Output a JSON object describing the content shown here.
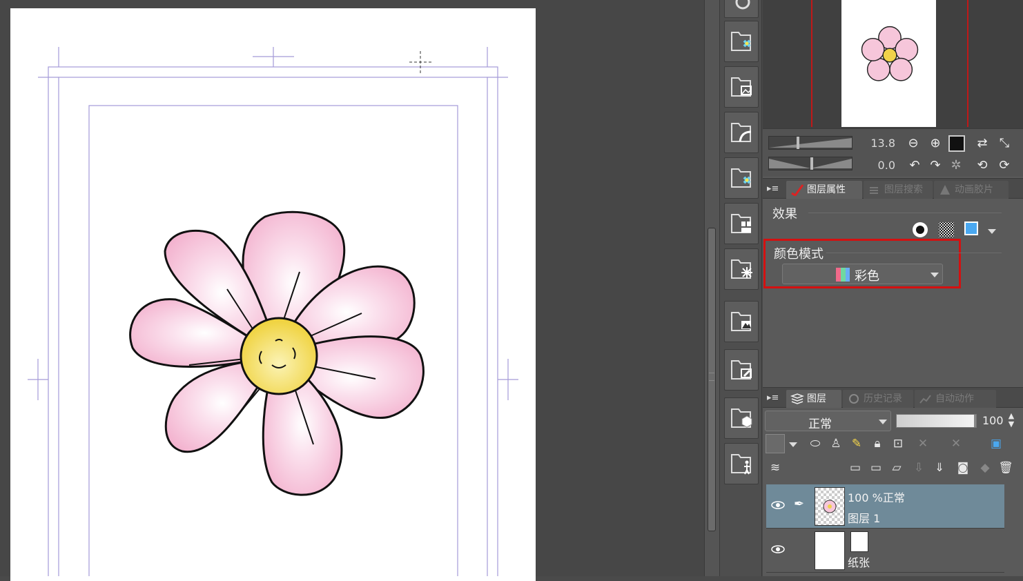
{
  "navigator": {
    "zoom": "13.8",
    "rotation": "0.0"
  },
  "properties_panel": {
    "tabs": [
      "图层属性",
      "图层搜索",
      "动画胶片"
    ],
    "effect_label": "效果",
    "color_mode_label": "颜色模式",
    "color_mode_value": "彩色"
  },
  "layer_panel": {
    "tabs": [
      "图层",
      "历史记录",
      "自动动作"
    ],
    "blend_mode": "正常",
    "opacity": "100",
    "layers": [
      {
        "info": "100 %正常",
        "name": "图层 1"
      },
      {
        "info": "",
        "name": "纸张"
      }
    ]
  },
  "colors": {
    "highlight": "#d41010",
    "selected_layer": "#6f8a99",
    "petal_pink": "#f4b8d2",
    "center_yellow": "#f3d84a"
  },
  "icons": [
    "zoom-out-icon",
    "zoom-in-icon",
    "fit-icon",
    "flip-icon",
    "rotate-left-icon",
    "rotate-right-icon",
    "reset-rotation-icon",
    "eye-icon",
    "pen-icon",
    "lock-icon",
    "trash-icon"
  ]
}
